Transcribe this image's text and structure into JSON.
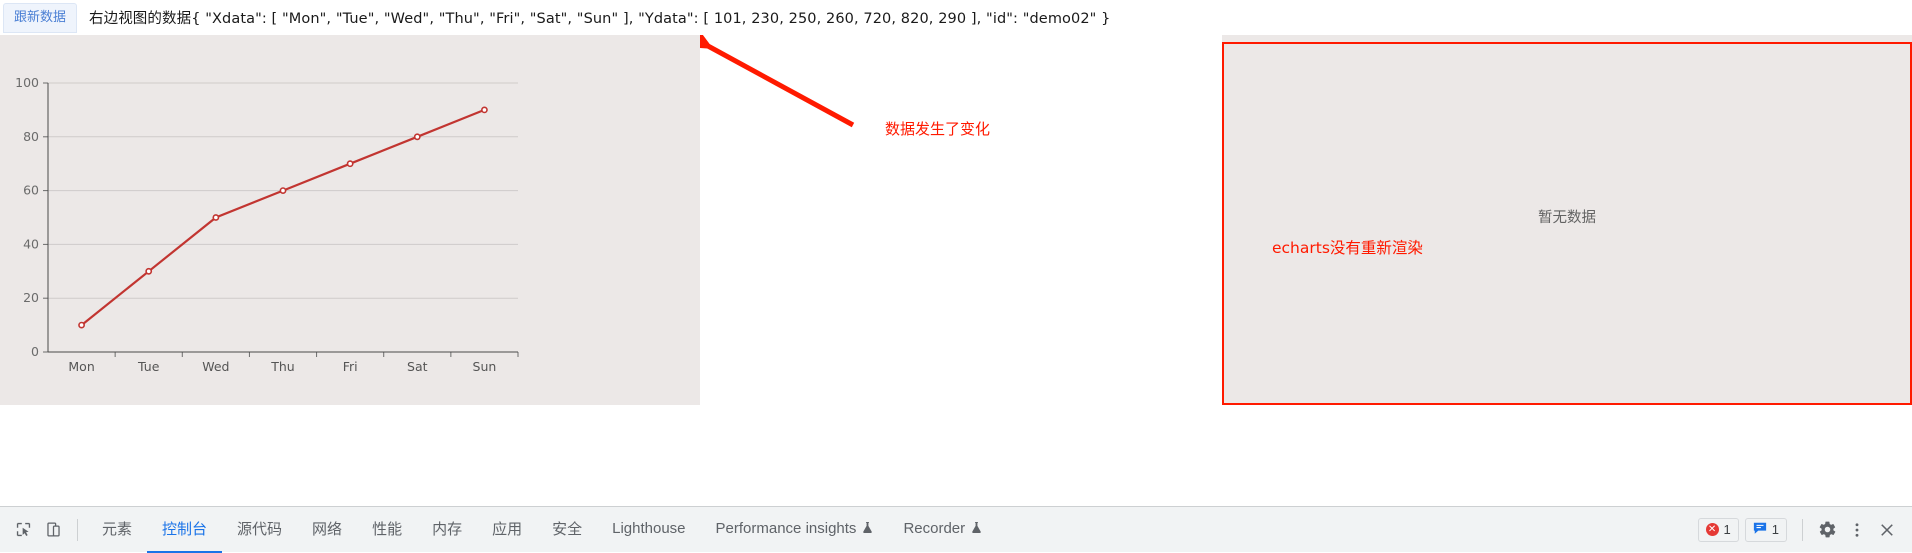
{
  "toolbar": {
    "update_button_label": "跟新数据",
    "debug_prefix": "右边视图的数据",
    "debug_text": "右边视图的数据{ \"Xdata\": [ \"Mon\", \"Tue\", \"Wed\", \"Thu\", \"Fri\", \"Sat\", \"Sun\" ], \"Ydata\": [ 101, 230, 250, 260, 720, 820, 290 ], \"id\": \"demo02\" }",
    "payload": {
      "Xdata": [
        "Mon",
        "Tue",
        "Wed",
        "Thu",
        "Fri",
        "Sat",
        "Sun"
      ],
      "Ydata": [
        101,
        230,
        250,
        260,
        720,
        820,
        290
      ],
      "id": "demo02"
    }
  },
  "annotations": {
    "arrow_label": "数据发生了变化",
    "right_note": "echarts没有重新渲染",
    "accent_color": "#ff1a00"
  },
  "right_panel": {
    "empty_text": "暂无数据"
  },
  "chart_data": {
    "type": "line",
    "title": "",
    "xlabel": "",
    "ylabel": "",
    "categories": [
      "Mon",
      "Tue",
      "Wed",
      "Thu",
      "Fri",
      "Sat",
      "Sun"
    ],
    "values": [
      10,
      30,
      50,
      60,
      70,
      80,
      90
    ],
    "ylim": [
      0,
      100
    ],
    "yticks": [
      0,
      20,
      40,
      60,
      80,
      100
    ],
    "grid": true,
    "legend": "none",
    "line_color": "#c23531",
    "symbol": "circle",
    "background": "#ece8e7"
  },
  "devtools": {
    "tabs": [
      {
        "label": "元素",
        "active": false,
        "flask": false
      },
      {
        "label": "控制台",
        "active": true,
        "flask": false
      },
      {
        "label": "源代码",
        "active": false,
        "flask": false
      },
      {
        "label": "网络",
        "active": false,
        "flask": false
      },
      {
        "label": "性能",
        "active": false,
        "flask": false
      },
      {
        "label": "内存",
        "active": false,
        "flask": false
      },
      {
        "label": "应用",
        "active": false,
        "flask": false
      },
      {
        "label": "安全",
        "active": false,
        "flask": false
      },
      {
        "label": "Lighthouse",
        "active": false,
        "flask": false
      },
      {
        "label": "Performance insights",
        "active": false,
        "flask": true
      },
      {
        "label": "Recorder",
        "active": false,
        "flask": true
      }
    ],
    "error_count": "1",
    "message_count": "1"
  }
}
